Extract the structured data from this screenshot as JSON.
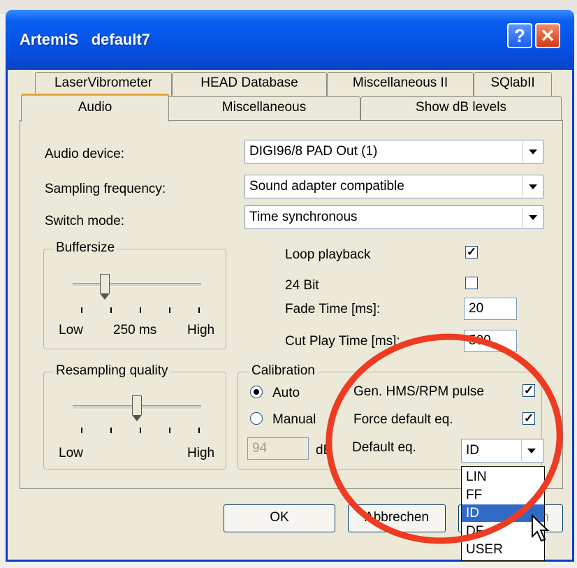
{
  "window": {
    "title": "ArtemiS   default7",
    "help_glyph": "?",
    "close_glyph": "✕"
  },
  "tabs": {
    "row_back": [
      "LaserVibrometer",
      "HEAD Database",
      "Miscellaneous II",
      "SQlabII"
    ],
    "row_front": [
      "Audio",
      "Miscellaneous",
      "Show dB levels"
    ],
    "active": "Audio"
  },
  "audio": {
    "audio_device_label": "Audio device:",
    "audio_device_value": "DIGI96/8 PAD Out (1)",
    "sampling_label": "Sampling frequency:",
    "sampling_value": "Sound adapter compatible",
    "switch_label": "Switch mode:",
    "switch_value": "Time synchronous",
    "buffersize": {
      "title": "Buffersize",
      "low": "Low",
      "mid": "250 ms",
      "high": "High",
      "level": 0.25
    },
    "resampling": {
      "title": "Resampling quality",
      "low": "Low",
      "high": "High",
      "level": 0.5
    },
    "loop_label": "Loop playback",
    "loop_checked": true,
    "bit24_label": "24 Bit",
    "bit24_checked": false,
    "fade_label": "Fade Time [ms]:",
    "fade_value": "20",
    "cut_label": "Cut Play Time [ms]:",
    "cut_value": "500",
    "calibration": {
      "title": "Calibration",
      "auto_label": "Auto",
      "manual_label": "Manual",
      "selected": "Auto",
      "db_value": "94",
      "db_unit": "dB"
    },
    "hms_label": "Gen. HMS/RPM pulse",
    "hms_checked": true,
    "force_label": "Force default eq.",
    "force_checked": true,
    "default_eq_label": "Default eq.",
    "default_eq_value": "ID",
    "default_eq_options": [
      "LIN",
      "FF",
      "ID",
      "DF",
      "USER"
    ]
  },
  "buttons": {
    "ok": "OK",
    "cancel": "Abbrechen",
    "apply": "Übernehmen"
  },
  "annotation_color": "#ee3b22"
}
